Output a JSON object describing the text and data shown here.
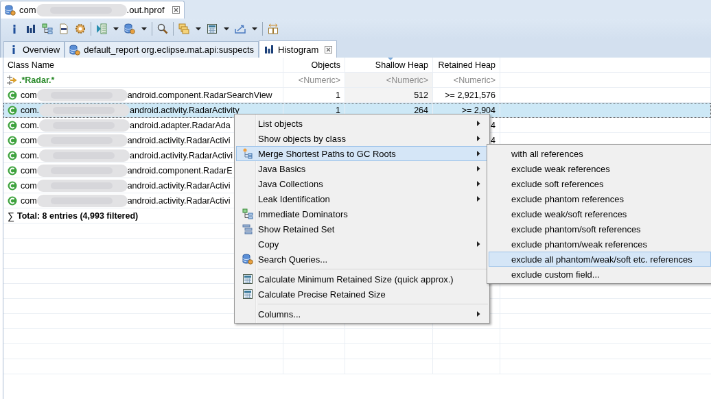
{
  "editor_tab": {
    "title_prefix": "com",
    "title_suffix": ".out.hprof",
    "selected": true
  },
  "toolbar": [
    {
      "kind": "info",
      "dropdown": false
    },
    {
      "kind": "histogram",
      "dropdown": false
    },
    {
      "kind": "dominator",
      "dropdown": false
    },
    {
      "kind": "oql",
      "dropdown": false
    },
    {
      "kind": "gear",
      "dropdown": false
    },
    {
      "kind": "separator"
    },
    {
      "kind": "expert",
      "dropdown": true
    },
    {
      "kind": "query",
      "dropdown": true
    },
    {
      "kind": "separator"
    },
    {
      "kind": "search",
      "dropdown": false
    },
    {
      "kind": "separator"
    },
    {
      "kind": "group",
      "dropdown": true
    },
    {
      "kind": "calculator",
      "dropdown": true
    },
    {
      "kind": "export",
      "dropdown": true
    },
    {
      "kind": "separator"
    },
    {
      "kind": "columns",
      "dropdown": false
    }
  ],
  "tabs": [
    {
      "label": "Overview",
      "selected": false,
      "closable": false
    },
    {
      "label": "default_report  org.eclipse.mat.api:suspects",
      "selected": false,
      "closable": false
    },
    {
      "label": "Histogram",
      "selected": true,
      "closable": true
    }
  ],
  "table": {
    "columns": [
      {
        "label": "Class Name",
        "sorted": false
      },
      {
        "label": "Objects",
        "sorted": false
      },
      {
        "label": "Shallow Heap",
        "sorted": true
      },
      {
        "label": "Retained Heap",
        "sorted": false
      }
    ],
    "filter_row": [
      ".*Radar.*",
      "<Numeric>",
      "<Numeric>",
      "<Numeric>"
    ],
    "rows": [
      {
        "prefix": "com",
        "suffix": "android.component.RadarSearchView",
        "objects": "1",
        "shallow_heap": "512",
        "retained_heap": ">= 2,921,576",
        "selected": false
      },
      {
        "prefix": "com.",
        "suffix": "android.activity.RadarActivity",
        "objects": "1",
        "shallow_heap": "264",
        "retained_heap": ">= 2,904",
        "selected": true
      },
      {
        "prefix": "com.",
        "suffix": "android.adapter.RadarAda",
        "retained_heap": "4",
        "selected": false
      },
      {
        "prefix": "com",
        "suffix": "android.activity.RadarActivi",
        "retained_heap": "4",
        "selected": false
      },
      {
        "prefix": "com.",
        "suffix": "android.activity.RadarActivi",
        "selected": false
      },
      {
        "prefix": "com",
        "suffix": "android.component.RadarE",
        "selected": false
      },
      {
        "prefix": "com",
        "suffix": "android.activity.RadarActivi",
        "selected": false
      },
      {
        "prefix": "com",
        "suffix": "android.activity.RadarActivi",
        "selected": false
      }
    ],
    "total": {
      "symbol": "∑",
      "text": "Total: 8 entries (4,993 filtered)"
    }
  },
  "context_menu": [
    {
      "kind": "item",
      "label": "List objects",
      "submenu": true,
      "selected": false
    },
    {
      "kind": "item",
      "label": "Show objects by class",
      "submenu": true,
      "selected": false
    },
    {
      "kind": "item",
      "label": "Merge Shortest Paths to GC Roots",
      "submenu": true,
      "selected": true
    },
    {
      "kind": "item",
      "label": "Java Basics",
      "submenu": true,
      "selected": false
    },
    {
      "kind": "item",
      "label": "Java Collections",
      "submenu": true,
      "selected": false
    },
    {
      "kind": "item",
      "label": "Leak Identification",
      "submenu": true,
      "selected": false
    },
    {
      "kind": "item",
      "label": "Immediate Dominators",
      "submenu": false,
      "selected": false
    },
    {
      "kind": "item",
      "label": "Show Retained Set",
      "submenu": false,
      "selected": false
    },
    {
      "kind": "item",
      "label": "Copy",
      "submenu": true,
      "selected": false
    },
    {
      "kind": "item",
      "label": "Search Queries...",
      "submenu": false,
      "selected": false
    },
    {
      "kind": "separator"
    },
    {
      "kind": "item",
      "label": "Calculate Minimum Retained Size (quick approx.)",
      "submenu": false,
      "selected": false
    },
    {
      "kind": "item",
      "label": "Calculate Precise Retained Size",
      "submenu": false,
      "selected": false
    },
    {
      "kind": "separator"
    },
    {
      "kind": "item",
      "label": "Columns...",
      "submenu": true,
      "selected": false
    }
  ],
  "submenu": [
    {
      "label": "with all references",
      "selected": false
    },
    {
      "label": "exclude weak references",
      "selected": false
    },
    {
      "label": "exclude soft references",
      "selected": false
    },
    {
      "label": "exclude phantom references",
      "selected": false
    },
    {
      "label": "exclude weak/soft references",
      "selected": false
    },
    {
      "label": "exclude phantom/soft references",
      "selected": false
    },
    {
      "label": "exclude phantom/weak references",
      "selected": false
    },
    {
      "label": "exclude all phantom/weak/soft etc. references",
      "selected": true
    },
    {
      "label": "exclude custom field...",
      "selected": false
    }
  ]
}
